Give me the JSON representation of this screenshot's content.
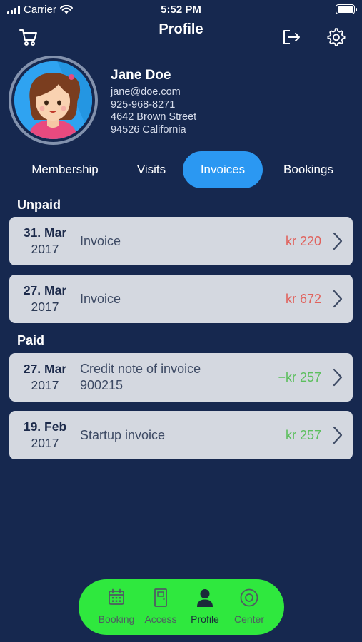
{
  "status_bar": {
    "carrier": "Carrier",
    "time": "5:52 PM"
  },
  "header": {
    "title": "Profile",
    "icons": {
      "left": "cart-icon",
      "right": [
        "logout-icon",
        "gear-icon"
      ]
    }
  },
  "profile": {
    "name": "Jane Doe",
    "email": "jane@doe.com",
    "phone": "925-968-8271",
    "street": "4642 Brown Street",
    "city": "94526 California"
  },
  "tabs": [
    {
      "label": "Membership",
      "active": false
    },
    {
      "label": "Visits",
      "active": false
    },
    {
      "label": "Invoices",
      "active": true
    },
    {
      "label": "Bookings",
      "active": false
    }
  ],
  "sections": {
    "unpaid": {
      "title": "Unpaid",
      "items": [
        {
          "day_month": "31. Mar",
          "year": "2017",
          "description": "Invoice",
          "amount": "kr 220",
          "status": "unpaid"
        },
        {
          "day_month": "27. Mar",
          "year": "2017",
          "description": "Invoice",
          "amount": "kr 672",
          "status": "unpaid"
        }
      ]
    },
    "paid": {
      "title": "Paid",
      "items": [
        {
          "day_month": "27. Mar",
          "year": "2017",
          "description": "Credit note of invoice 900215",
          "amount": "−kr 257",
          "status": "paid"
        },
        {
          "day_month": "19. Feb",
          "year": "2017",
          "description": "Startup invoice",
          "amount": "kr 257",
          "status": "paid"
        }
      ]
    }
  },
  "bottom_nav": [
    {
      "label": "Booking",
      "icon": "calendar-icon",
      "active": false
    },
    {
      "label": "Access",
      "icon": "door-icon",
      "active": false
    },
    {
      "label": "Profile",
      "icon": "person-icon",
      "active": true
    },
    {
      "label": "Center",
      "icon": "target-icon",
      "active": false
    }
  ],
  "colors": {
    "background": "#16284f",
    "accent_tab": "#2b98f2",
    "unpaid_amount": "#e0625d",
    "paid_amount": "#5cbf5e",
    "nav_bar": "#2fe83e",
    "card": "#d4d8e0"
  }
}
